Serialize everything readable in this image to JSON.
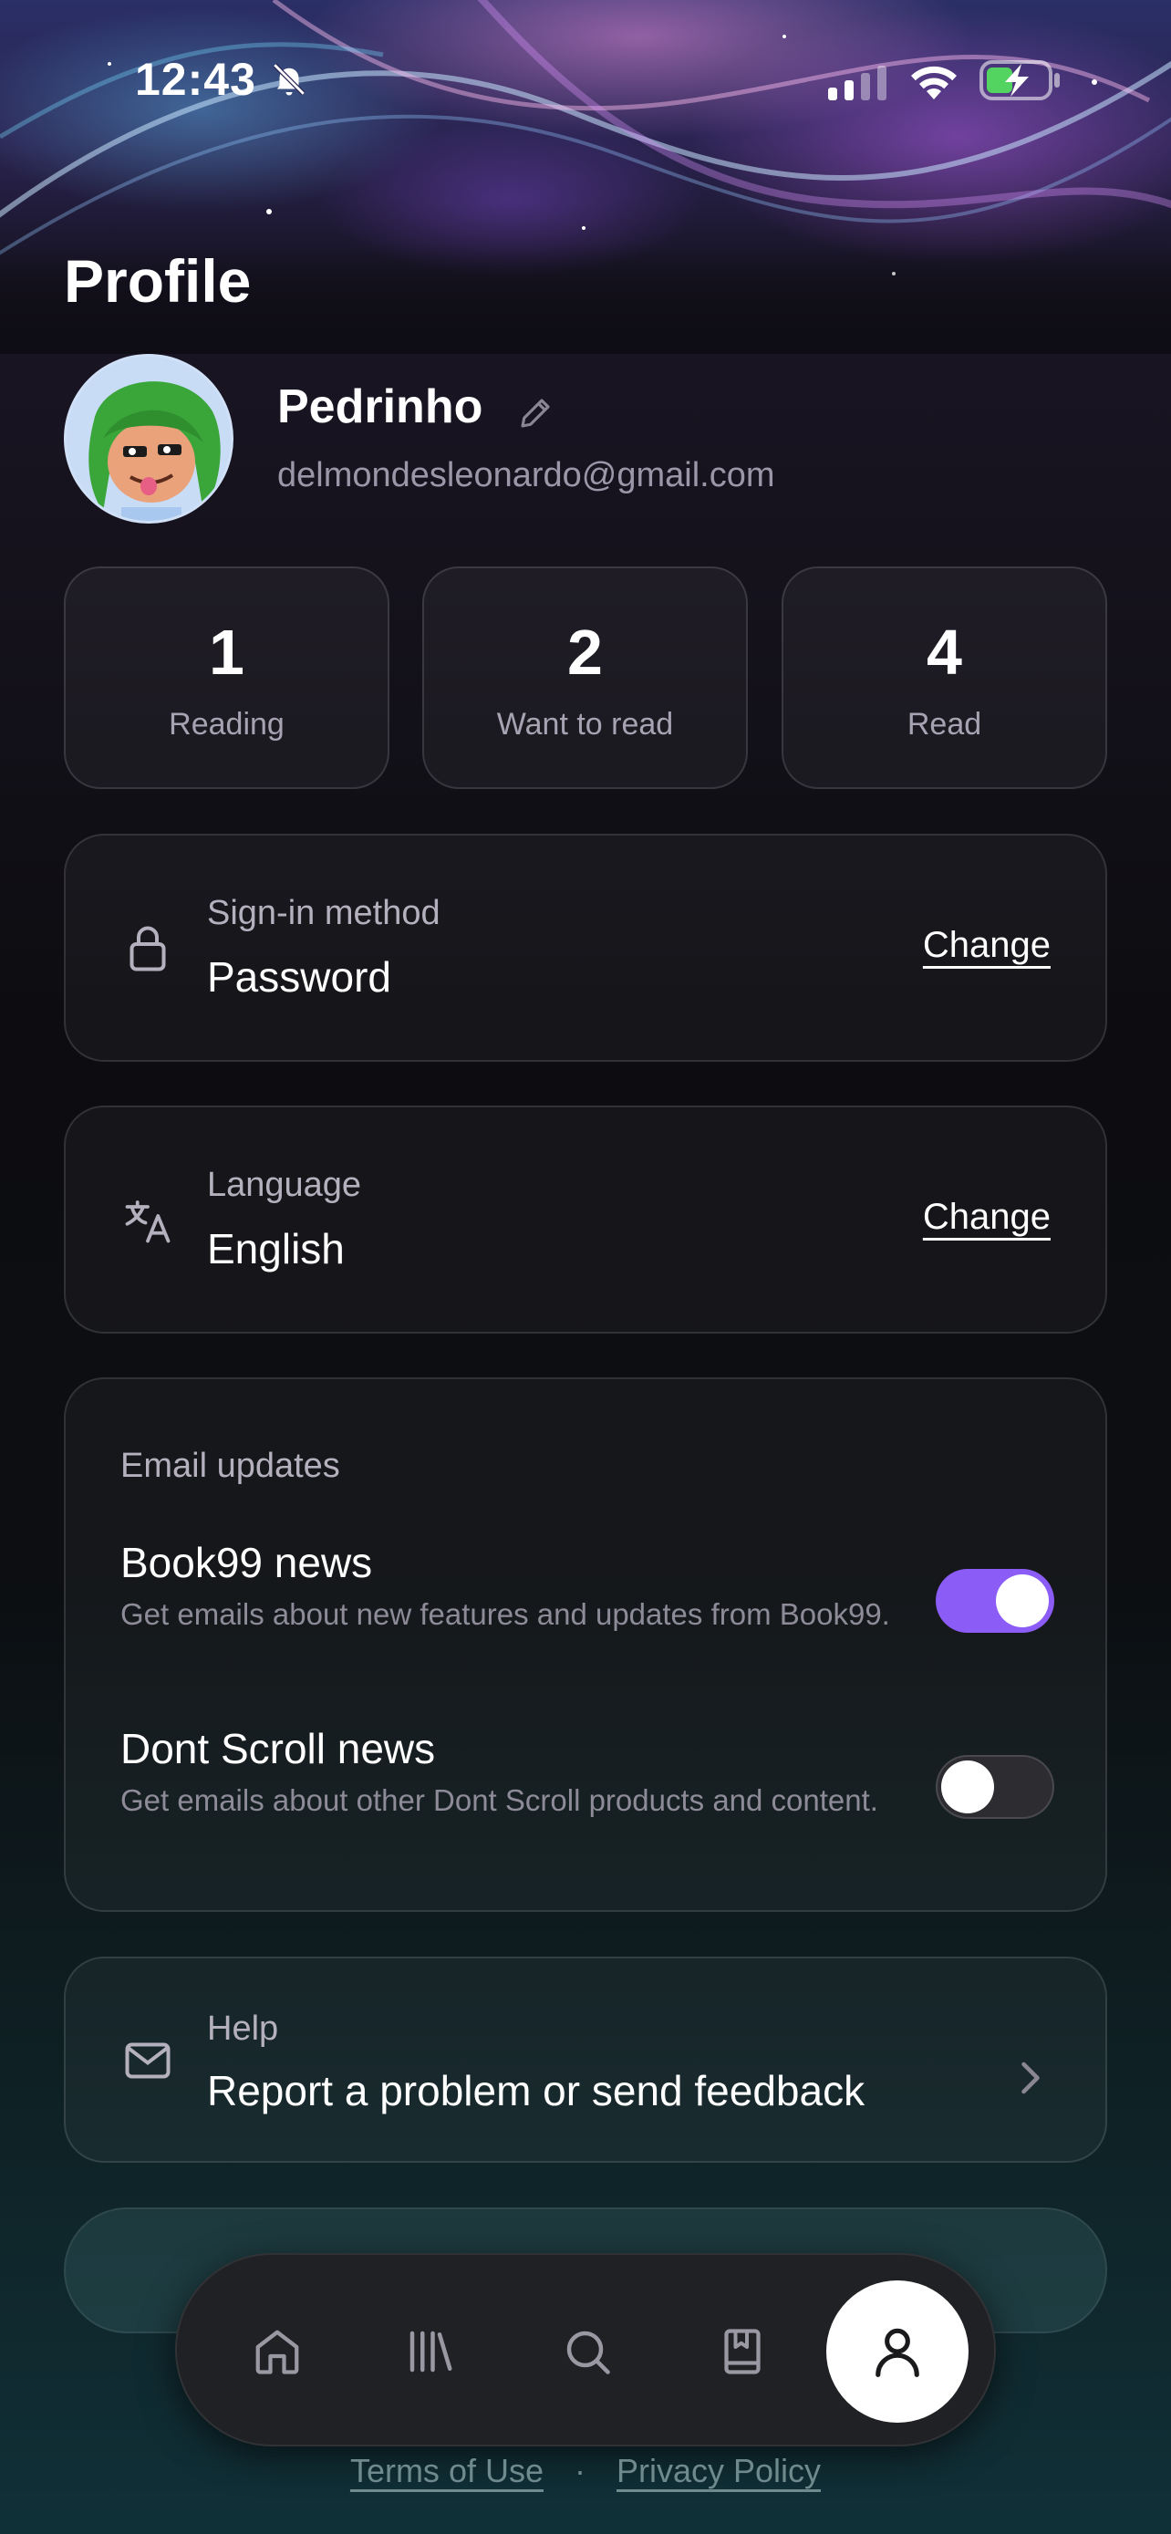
{
  "status_bar": {
    "time": "12:43"
  },
  "page": {
    "title": "Profile"
  },
  "profile": {
    "name": "Pedrinho",
    "email": "delmondesleonardo@gmail.com"
  },
  "stats": [
    {
      "value": "1",
      "label": "Reading"
    },
    {
      "value": "2",
      "label": "Want to read"
    },
    {
      "value": "4",
      "label": "Read"
    }
  ],
  "signin": {
    "label": "Sign-in method",
    "value": "Password",
    "action": "Change",
    "icon": "lock-icon"
  },
  "language": {
    "label": "Language",
    "value": "English",
    "action": "Change",
    "icon": "translate-icon"
  },
  "email_updates": {
    "title": "Email updates",
    "items": [
      {
        "title": "Book99 news",
        "description": "Get emails about new features and updates from Book99.",
        "enabled": true
      },
      {
        "title": "Dont Scroll news",
        "description": "Get emails about other Dont Scroll products and content.",
        "enabled": false
      }
    ]
  },
  "help": {
    "label": "Help",
    "value": "Report a problem or send feedback",
    "icon": "mail-icon"
  },
  "tabbar": {
    "items": [
      {
        "icon": "home-icon"
      },
      {
        "icon": "library-icon"
      },
      {
        "icon": "search-icon"
      },
      {
        "icon": "bookmark-book-icon"
      },
      {
        "icon": "profile-icon",
        "active": true
      }
    ]
  },
  "footer": {
    "terms": "Terms of Use",
    "separator": "·",
    "privacy": "Privacy Policy"
  },
  "colors": {
    "accent": "#8b5cf6",
    "background": "#0c0e11"
  }
}
